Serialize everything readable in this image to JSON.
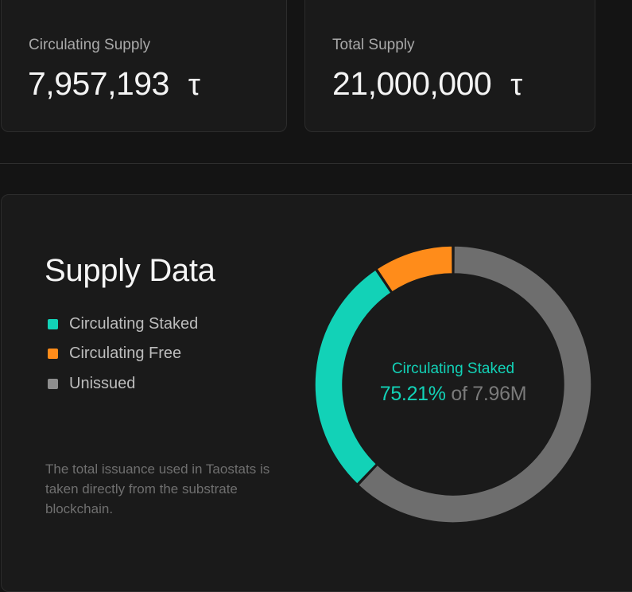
{
  "cards": {
    "circulating": {
      "label": "Circulating Supply",
      "value": "7,957,193",
      "unit": "τ"
    },
    "total": {
      "label": "Total Supply",
      "value": "21,000,000",
      "unit": "τ"
    }
  },
  "supply": {
    "title": "Supply Data",
    "legend": [
      {
        "label": "Circulating Staked",
        "color": "#12d2b7"
      },
      {
        "label": "Circulating Free",
        "color": "#ff8c1a"
      },
      {
        "label": "Unissued",
        "color": "#8e8e8e"
      }
    ],
    "footnote": "The total issuance used in Taostats is taken directly from the substrate blockchain.",
    "center": {
      "label": "Circulating Staked",
      "percent": "75.21%",
      "of_text": "of 7.96M"
    }
  },
  "chart_data": {
    "type": "pie",
    "categories": [
      "Circulating Staked",
      "Circulating Free",
      "Unissued"
    ],
    "values": [
      5984805,
      1972388,
      13042807
    ],
    "colors": [
      "#12d2b7",
      "#ff8c1a",
      "#6e6e6e"
    ]
  }
}
